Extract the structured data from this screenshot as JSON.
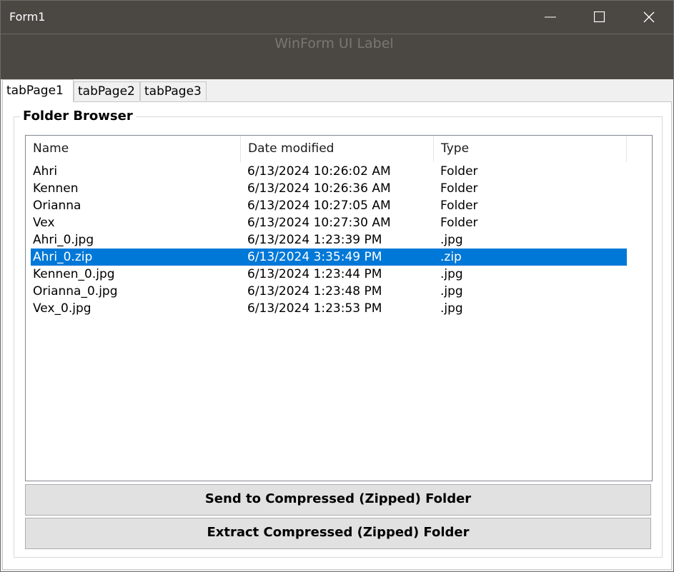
{
  "window": {
    "title": "Form1",
    "minimize_glyph": "—",
    "maximize_glyph": "☐",
    "close_glyph": "✕"
  },
  "banner": {
    "label": "WinForm UI Label"
  },
  "tabs": [
    {
      "label": "tabPage1",
      "active": true
    },
    {
      "label": "tabPage2",
      "active": false
    },
    {
      "label": "tabPage3",
      "active": false
    }
  ],
  "group": {
    "title": "Folder Browser"
  },
  "listview": {
    "columns": [
      "Name",
      "Date modified",
      "Type"
    ],
    "rows": [
      {
        "name": "Ahri",
        "date": "6/13/2024 10:26:02 AM",
        "type": "Folder",
        "selected": false
      },
      {
        "name": "Kennen",
        "date": "6/13/2024 10:26:36 AM",
        "type": "Folder",
        "selected": false
      },
      {
        "name": "Orianna",
        "date": "6/13/2024 10:27:05 AM",
        "type": "Folder",
        "selected": false
      },
      {
        "name": "Vex",
        "date": "6/13/2024 10:27:30 AM",
        "type": "Folder",
        "selected": false
      },
      {
        "name": "Ahri_0.jpg",
        "date": "6/13/2024 1:23:39 PM",
        "type": ".jpg",
        "selected": false
      },
      {
        "name": "Ahri_0.zip",
        "date": "6/13/2024 3:35:49 PM",
        "type": ".zip",
        "selected": true
      },
      {
        "name": "Kennen_0.jpg",
        "date": "6/13/2024 1:23:44 PM",
        "type": ".jpg",
        "selected": false
      },
      {
        "name": "Orianna_0.jpg",
        "date": "6/13/2024 1:23:48 PM",
        "type": ".jpg",
        "selected": false
      },
      {
        "name": "Vex_0.jpg",
        "date": "6/13/2024 1:23:53 PM",
        "type": ".jpg",
        "selected": false
      }
    ]
  },
  "buttons": {
    "send": "Send to Compressed (Zipped) Folder",
    "extract": "Extract Compressed (Zipped) Folder"
  },
  "colors": {
    "titlebar": "#4b4844",
    "selection": "#0078d7"
  }
}
